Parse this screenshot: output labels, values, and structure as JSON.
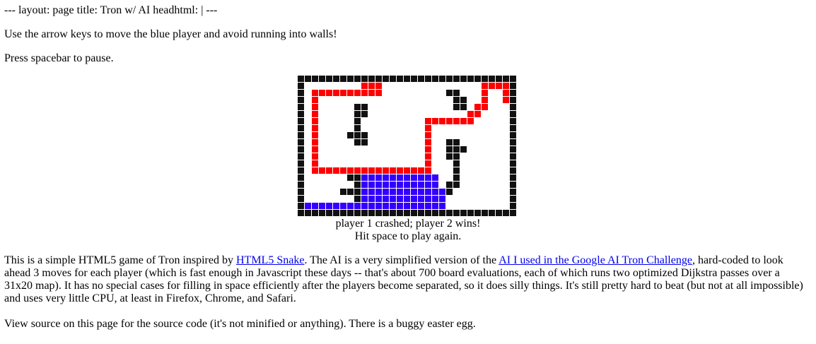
{
  "header": {
    "layout_line": "--- layout: page title: Tron w/ AI headhtml: | ---"
  },
  "instructions": {
    "move": "Use the arrow keys to move the blue player and avoid running into walls!",
    "pause": "Press spacebar to pause."
  },
  "game": {
    "grid_cols": 31,
    "grid_rows": 20,
    "colors": {
      "wall": "#111111",
      "player1": "#3300ff",
      "player2": "#ff0000",
      "background": "#ffffff"
    },
    "status_line1": "player 1 crashed; player 2 wins!",
    "status_line2": "Hit space to play again."
  },
  "description": {
    "text1": "This is a simple HTML5 game of Tron inspired by ",
    "link1": "HTML5 Snake",
    "text2": ". The AI is a very simplified version of the ",
    "link2": "AI I used in the Google AI Tron Challenge",
    "text3": ", hard-coded to look ahead 3 moves for each player (which is fast enough in Javascript these days -- that's about 700 board evaluations, each of which runs two optimized Dijkstra passes over a 31x20 map). It has no special cases for filling in space efficiently after the players become separated, so it does silly things. It's still pretty hard to beat (but not at all impossible) and uses very little CPU, at least in Firefox, Chrome, and Safari.",
    "source_note": "View source on this page for the source code (it's not minified or anything). There is a buggy easter egg."
  }
}
